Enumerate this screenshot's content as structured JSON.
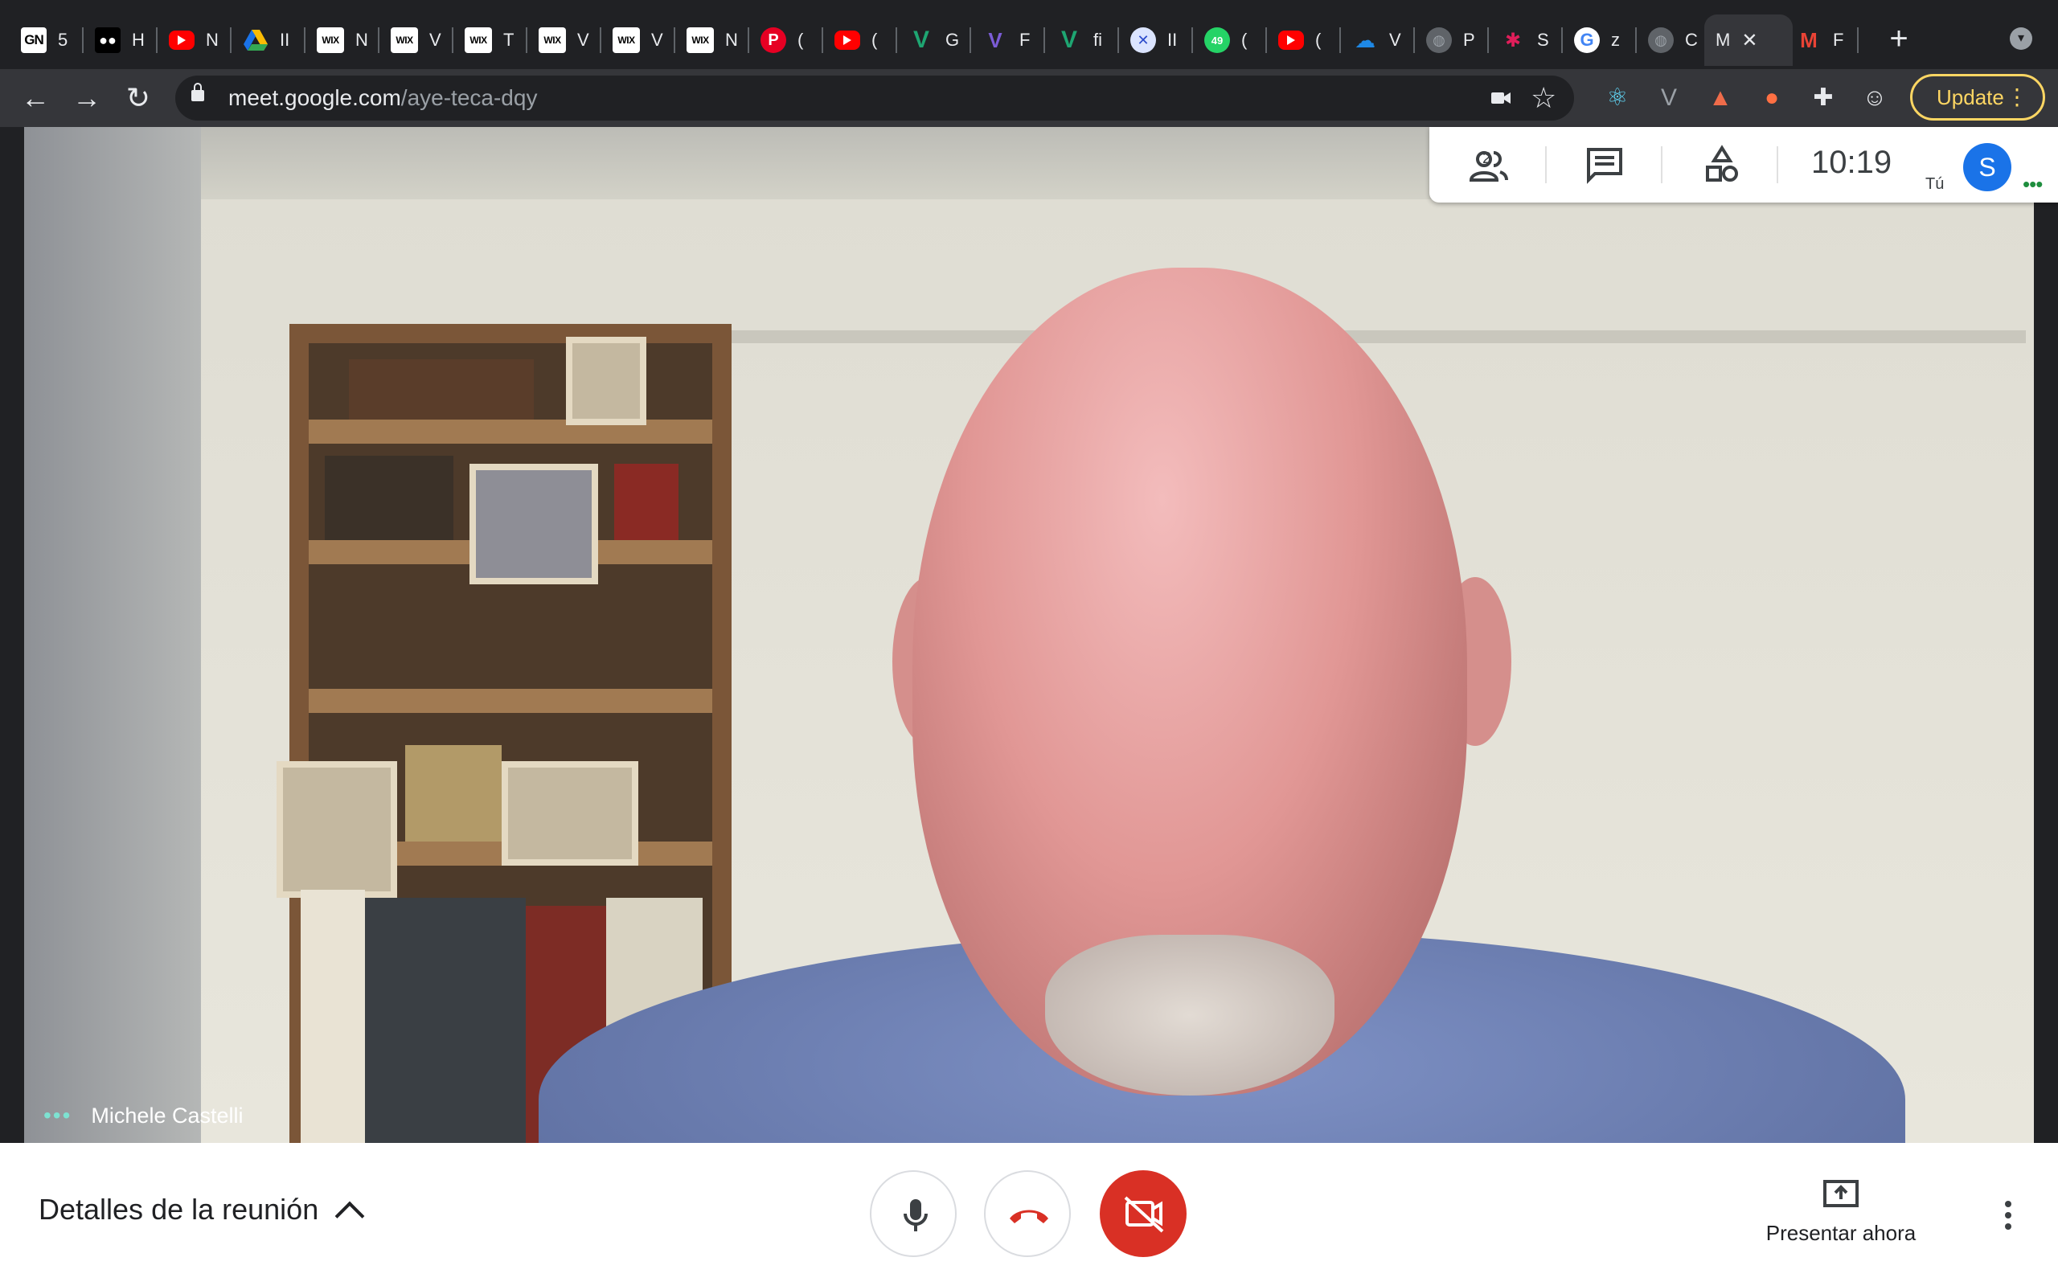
{
  "browser": {
    "tabs": [
      {
        "icon": "gn-icon",
        "fav_text": "GN",
        "label": "5"
      },
      {
        "icon": "medium-icon",
        "fav_text": "●●",
        "label": "H"
      },
      {
        "icon": "youtube-icon",
        "fav_text": "",
        "label": "N"
      },
      {
        "icon": "google-drive-icon",
        "fav_text": "▲",
        "label": "II"
      },
      {
        "icon": "wix-icon",
        "fav_text": "WIX",
        "label": "N"
      },
      {
        "icon": "wix-icon",
        "fav_text": "WIX",
        "label": "V"
      },
      {
        "icon": "wix-icon",
        "fav_text": "WIX",
        "label": "T"
      },
      {
        "icon": "wix-icon",
        "fav_text": "WIX",
        "label": "V"
      },
      {
        "icon": "wix-icon",
        "fav_text": "WIX",
        "label": "V"
      },
      {
        "icon": "wix-icon",
        "fav_text": "WIX",
        "label": "N"
      },
      {
        "icon": "pinterest-icon",
        "fav_text": "P",
        "label": "("
      },
      {
        "icon": "youtube-icon",
        "fav_text": "",
        "label": "("
      },
      {
        "icon": "vuejs-icon",
        "fav_text": "V",
        "label": "G"
      },
      {
        "icon": "vuejs-beta-icon",
        "fav_text": "V",
        "label": "F"
      },
      {
        "icon": "vuejs-icon",
        "fav_text": "V",
        "label": "fi"
      },
      {
        "icon": "x-icon",
        "fav_text": "✕",
        "label": "II"
      },
      {
        "icon": "whatsapp-icon",
        "fav_text": "49",
        "label": "("
      },
      {
        "icon": "youtube-icon",
        "fav_text": "",
        "label": "("
      },
      {
        "icon": "onedrive-icon",
        "fav_text": "☁",
        "label": "V"
      },
      {
        "icon": "globe-icon",
        "fav_text": "◍",
        "label": "P"
      },
      {
        "icon": "slack-icon",
        "fav_text": "✱",
        "label": "S"
      },
      {
        "icon": "google-icon",
        "fav_text": "G",
        "label": "z"
      },
      {
        "icon": "globe-icon",
        "fav_text": "◍",
        "label": "C"
      },
      {
        "icon": "meet-icon",
        "fav_text": "",
        "label": "M",
        "active": true
      },
      {
        "icon": "gmail-icon",
        "fav_text": "M",
        "label": "F"
      }
    ],
    "new_tab_glyph": "+",
    "tab_search_glyph": "▾",
    "tab_close_glyph": "✕",
    "nav": {
      "back": "←",
      "forward": "→",
      "reload": "↻"
    },
    "url_host": "meet.google.com",
    "url_path": "/aye-teca-dqy",
    "star_glyph": "☆",
    "extensions": [
      {
        "icon": "react-devtools-icon",
        "glyph": "⚛",
        "color": "#61dafb"
      },
      {
        "icon": "vue-devtools-icon",
        "glyph": "V",
        "color": "#9aa0a6"
      },
      {
        "icon": "rocket-extension-icon",
        "glyph": "▲",
        "color": "#ef6c4a"
      },
      {
        "icon": "fire-extension-icon",
        "glyph": "●",
        "color": "#ff7043"
      },
      {
        "icon": "puzzle-icon",
        "glyph": "✚",
        "color": "#e8eaed"
      },
      {
        "icon": "profile-icon",
        "glyph": "☺",
        "color": "#e8eaed"
      }
    ],
    "update_label": "Update",
    "update_more_glyph": "⋮",
    "colors": {
      "update": "#fdd663",
      "toolbar": "#35363a",
      "tabstrip": "#202124"
    }
  },
  "meet": {
    "participant_name": "Michele Castelli",
    "participant_dots": "•••",
    "info_panel": {
      "people_count": "2",
      "clock": "10:19",
      "you_label": "Tú",
      "avatar_initial": "S",
      "more_dots": "•••"
    },
    "bottom": {
      "meeting_details": "Detalles de la reunión",
      "present_label": "Presentar ahora"
    },
    "colors": {
      "hangup": "#d93025",
      "camera_off_bg": "#d93025",
      "avatar": "#1a73e8",
      "name_dots": "#7de2d1"
    }
  }
}
